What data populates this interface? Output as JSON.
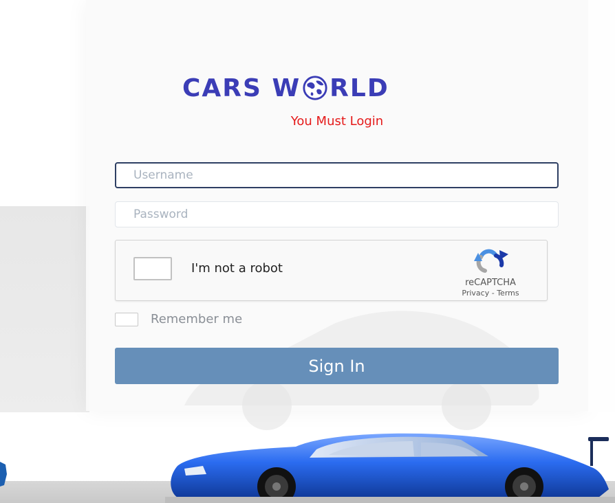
{
  "brand": {
    "logo_left": "CARS W",
    "logo_right": "RLD",
    "accent_color": "#3b3db6"
  },
  "alert": {
    "text": "You Must Login",
    "color": "#e51a1a"
  },
  "form": {
    "username_placeholder": "Username",
    "password_placeholder": "Password",
    "remember_label": "Remember me",
    "submit_label": "Sign In",
    "submit_color": "#668fb9"
  },
  "recaptcha": {
    "label": "I'm not a robot",
    "brand": "reCAPTCHA",
    "links": "Privacy - Terms",
    "icon": "recaptcha-logo-icon"
  },
  "illustration": {
    "icon": "sports-car-icon",
    "car_color": "#1f5ed8"
  }
}
